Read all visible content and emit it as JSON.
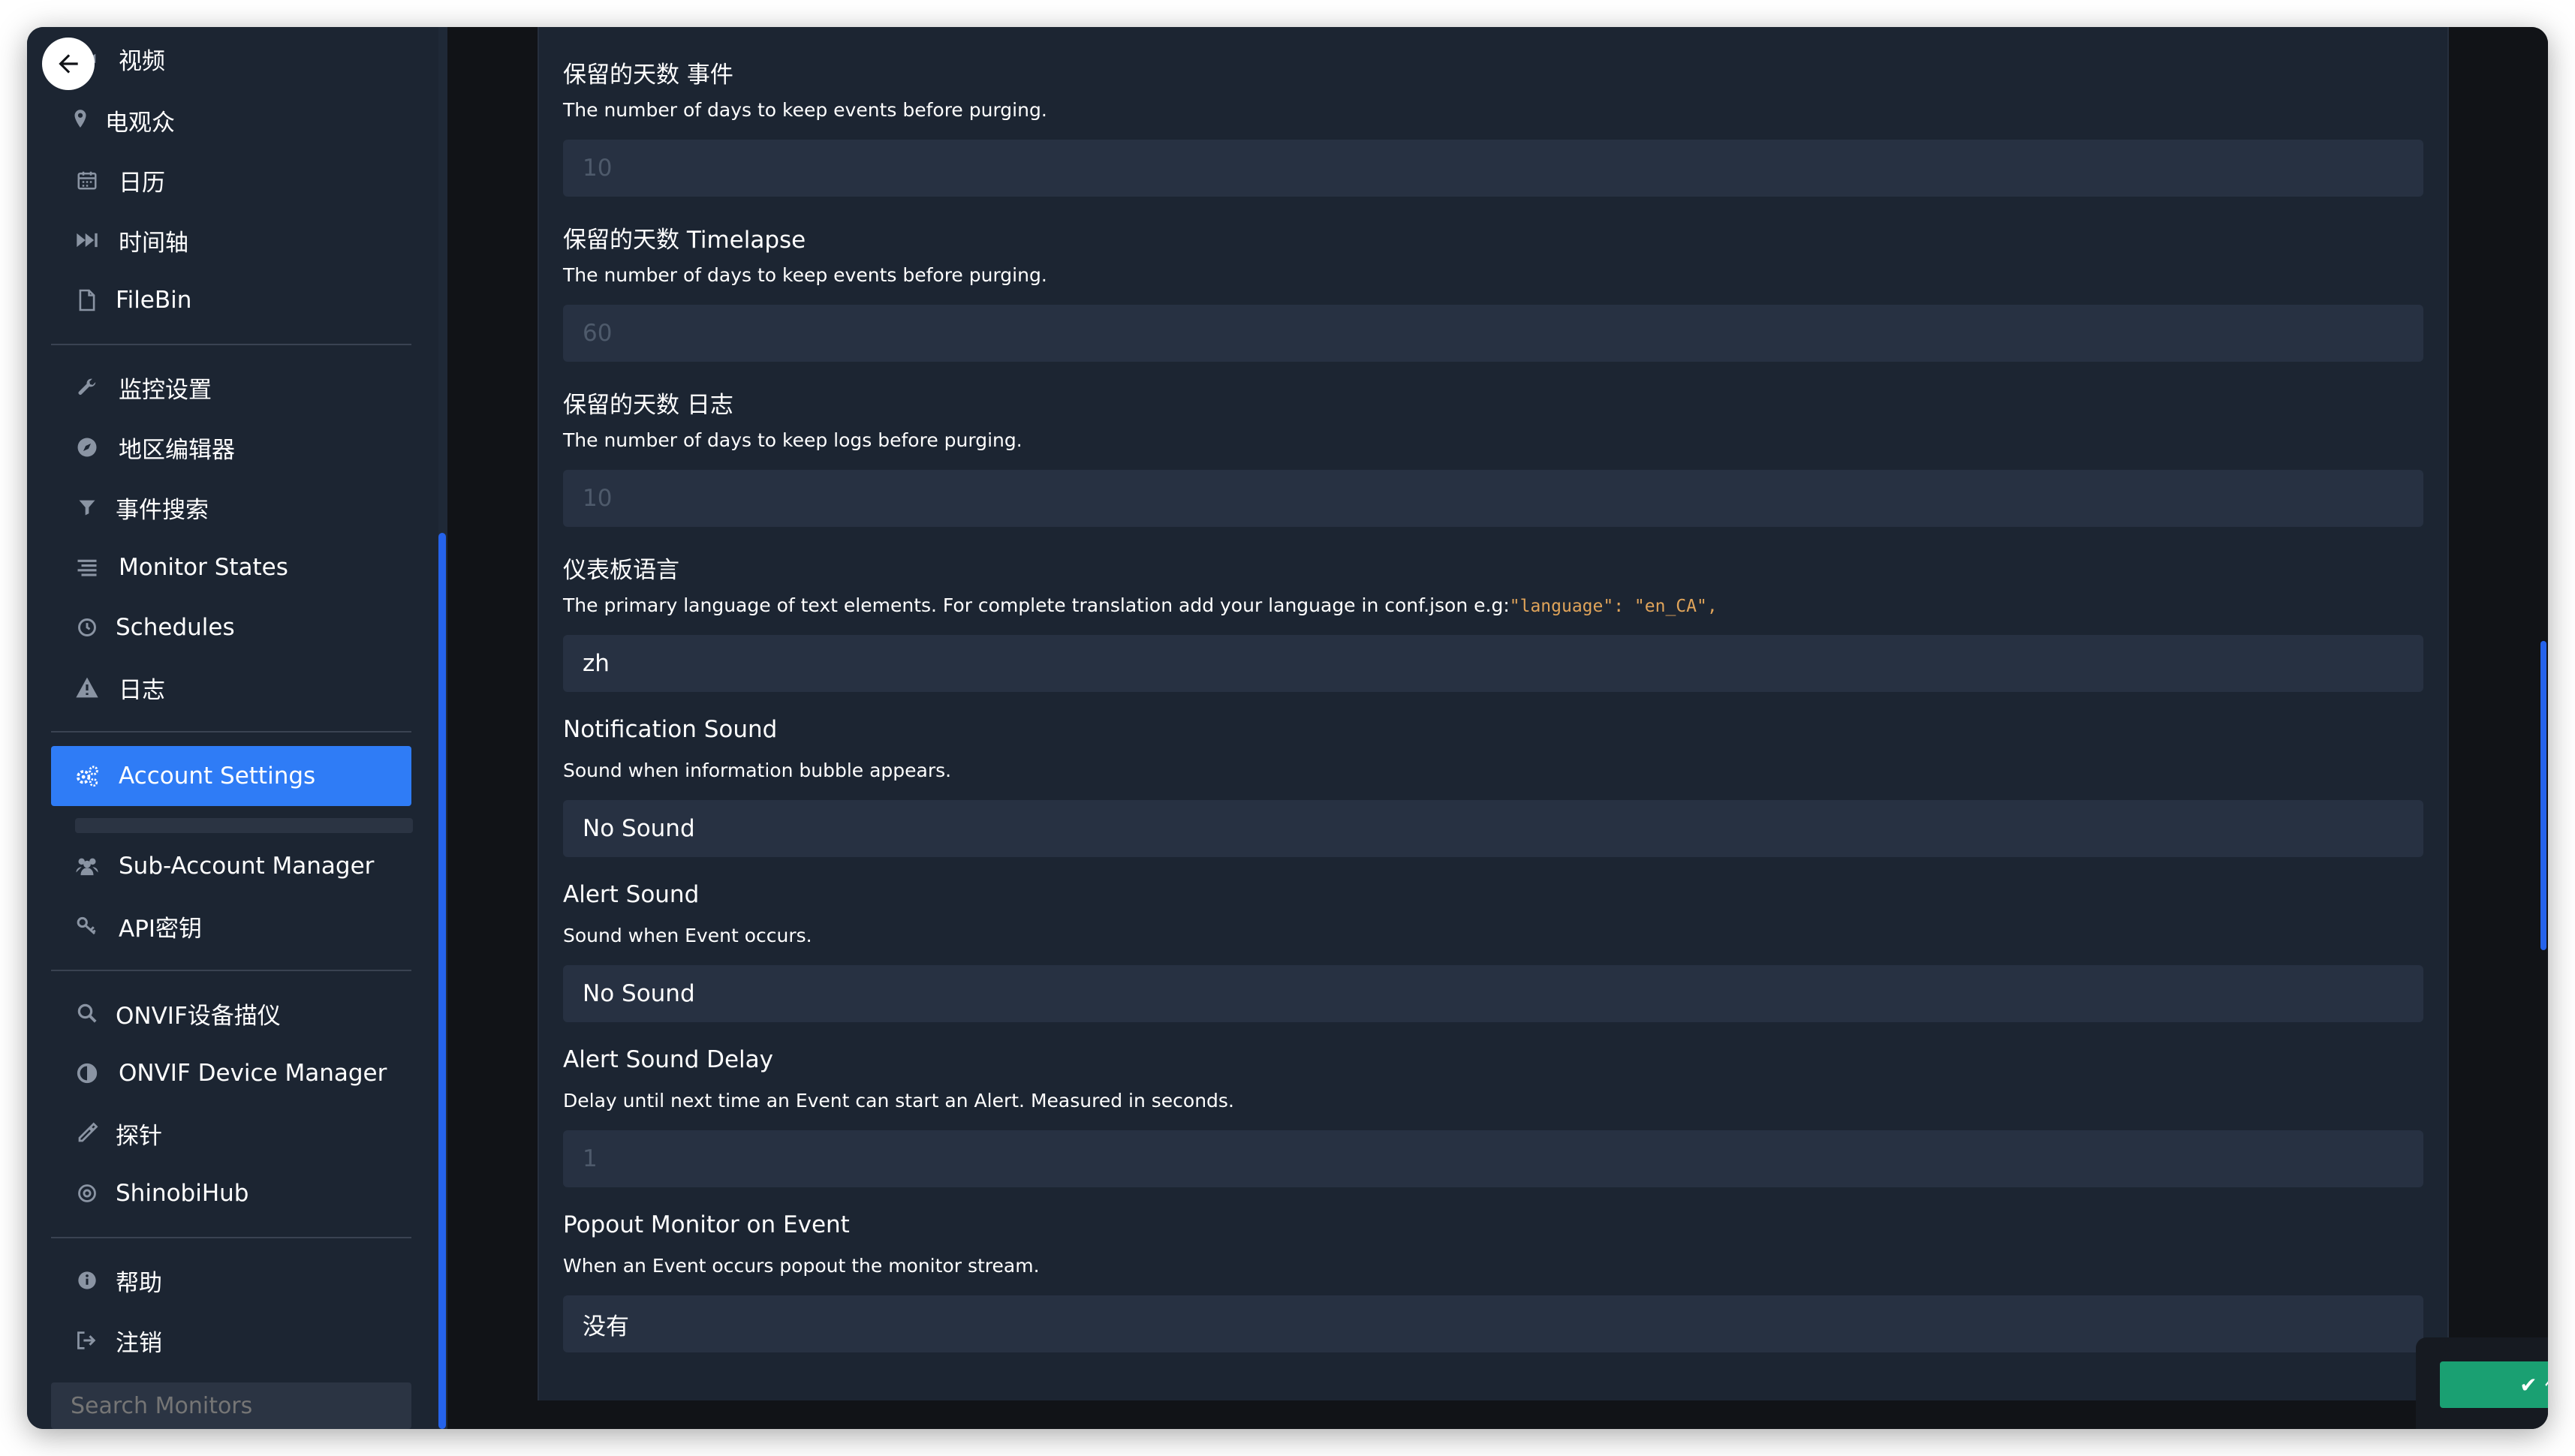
{
  "sidebar": {
    "items": [
      {
        "label": "视频",
        "icon": "video-icon"
      },
      {
        "label": "电观众",
        "icon": "map-pin-icon"
      },
      {
        "label": "日历",
        "icon": "calendar-icon"
      },
      {
        "label": "时间轴",
        "icon": "fast-forward-icon"
      },
      {
        "label": "FileBin",
        "icon": "file-icon"
      },
      {
        "label": "监控设置",
        "icon": "wrench-icon"
      },
      {
        "label": "地区编辑器",
        "icon": "compass-icon"
      },
      {
        "label": "事件搜索",
        "icon": "filter-icon"
      },
      {
        "label": "Monitor States",
        "icon": "list-icon"
      },
      {
        "label": "Schedules",
        "icon": "clock-icon"
      },
      {
        "label": "日志",
        "icon": "warning-icon"
      },
      {
        "label": "Account Settings",
        "icon": "gears-icon",
        "active": true
      },
      {
        "label": "Sub-Account Manager",
        "icon": "users-icon"
      },
      {
        "label": "API密钥",
        "icon": "key-icon"
      },
      {
        "label": "ONVIF设备描仪",
        "icon": "search-icon"
      },
      {
        "label": "ONVIF Device Manager",
        "icon": "circle-icon"
      },
      {
        "label": "探针",
        "icon": "eyedropper-icon"
      },
      {
        "label": "ShinobiHub",
        "icon": "hub-icon"
      },
      {
        "label": "帮助",
        "icon": "info-icon"
      },
      {
        "label": "注销",
        "icon": "sign-out-icon"
      }
    ],
    "search_placeholder": "Search Monitors"
  },
  "settings": [
    {
      "title": "保留的天数 事件",
      "desc": "The number of days to keep events before purging.",
      "value": "10",
      "placeholder": true
    },
    {
      "title": "保留的天数 Timelapse",
      "desc": "The number of days to keep events before purging.",
      "value": "60",
      "placeholder": true
    },
    {
      "title": "保留的天数 日志",
      "desc": "The number of days to keep logs before purging.",
      "value": "10",
      "placeholder": true
    },
    {
      "title": "仪表板语言",
      "desc": "The primary language of text elements. For complete translation add your language in conf.json e.g:",
      "desc_code": "\"language\": \"en_CA\",",
      "value": "zh",
      "placeholder": false
    },
    {
      "title": "Notification Sound",
      "desc": "Sound when information bubble appears.",
      "value": "No Sound",
      "placeholder": false
    },
    {
      "title": "Alert Sound",
      "desc": "Sound when Event occurs.",
      "value": "No Sound",
      "placeholder": false
    },
    {
      "title": "Alert Sound Delay",
      "desc": "Delay until next time an Event can start an Alert. Measured in seconds.",
      "value": "1",
      "placeholder": true
    },
    {
      "title": "Popout Monitor on Event",
      "desc": "When an Event occurs popout the monitor stream.",
      "value": "没有",
      "placeholder": false
    }
  ],
  "save_label": "保存",
  "colors": {
    "accent": "#2f7cf6",
    "save": "#1aa072",
    "sidebar_bg": "#1c2532",
    "input_bg": "#273142"
  }
}
